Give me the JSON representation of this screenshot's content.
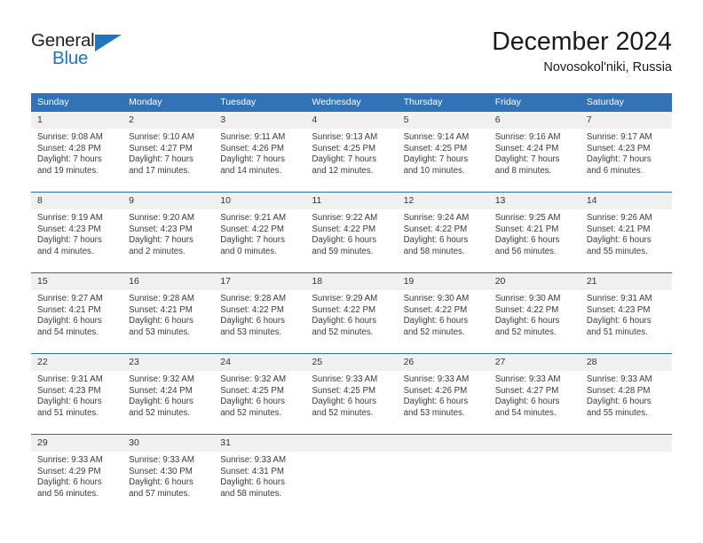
{
  "brand": {
    "name_top": "General",
    "name_bottom": "Blue",
    "color_dark": "#231f20",
    "color_blue": "#1f76bc"
  },
  "header": {
    "month_title": "December 2024",
    "location": "Novosokol'niki, Russia"
  },
  "theme": {
    "header_bg": "#3273b7",
    "row_divider": "#2e6da8",
    "daynum_bg": "#f0f0f0",
    "text": "#3a3a3a"
  },
  "weekday_headers": [
    "Sunday",
    "Monday",
    "Tuesday",
    "Wednesday",
    "Thursday",
    "Friday",
    "Saturday"
  ],
  "weeks": [
    [
      {
        "day": "1",
        "sunrise": "Sunrise: 9:08 AM",
        "sunset": "Sunset: 4:28 PM",
        "daylight1": "Daylight: 7 hours",
        "daylight2": "and 19 minutes."
      },
      {
        "day": "2",
        "sunrise": "Sunrise: 9:10 AM",
        "sunset": "Sunset: 4:27 PM",
        "daylight1": "Daylight: 7 hours",
        "daylight2": "and 17 minutes."
      },
      {
        "day": "3",
        "sunrise": "Sunrise: 9:11 AM",
        "sunset": "Sunset: 4:26 PM",
        "daylight1": "Daylight: 7 hours",
        "daylight2": "and 14 minutes."
      },
      {
        "day": "4",
        "sunrise": "Sunrise: 9:13 AM",
        "sunset": "Sunset: 4:25 PM",
        "daylight1": "Daylight: 7 hours",
        "daylight2": "and 12 minutes."
      },
      {
        "day": "5",
        "sunrise": "Sunrise: 9:14 AM",
        "sunset": "Sunset: 4:25 PM",
        "daylight1": "Daylight: 7 hours",
        "daylight2": "and 10 minutes."
      },
      {
        "day": "6",
        "sunrise": "Sunrise: 9:16 AM",
        "sunset": "Sunset: 4:24 PM",
        "daylight1": "Daylight: 7 hours",
        "daylight2": "and 8 minutes."
      },
      {
        "day": "7",
        "sunrise": "Sunrise: 9:17 AM",
        "sunset": "Sunset: 4:23 PM",
        "daylight1": "Daylight: 7 hours",
        "daylight2": "and 6 minutes."
      }
    ],
    [
      {
        "day": "8",
        "sunrise": "Sunrise: 9:19 AM",
        "sunset": "Sunset: 4:23 PM",
        "daylight1": "Daylight: 7 hours",
        "daylight2": "and 4 minutes."
      },
      {
        "day": "9",
        "sunrise": "Sunrise: 9:20 AM",
        "sunset": "Sunset: 4:23 PM",
        "daylight1": "Daylight: 7 hours",
        "daylight2": "and 2 minutes."
      },
      {
        "day": "10",
        "sunrise": "Sunrise: 9:21 AM",
        "sunset": "Sunset: 4:22 PM",
        "daylight1": "Daylight: 7 hours",
        "daylight2": "and 0 minutes."
      },
      {
        "day": "11",
        "sunrise": "Sunrise: 9:22 AM",
        "sunset": "Sunset: 4:22 PM",
        "daylight1": "Daylight: 6 hours",
        "daylight2": "and 59 minutes."
      },
      {
        "day": "12",
        "sunrise": "Sunrise: 9:24 AM",
        "sunset": "Sunset: 4:22 PM",
        "daylight1": "Daylight: 6 hours",
        "daylight2": "and 58 minutes."
      },
      {
        "day": "13",
        "sunrise": "Sunrise: 9:25 AM",
        "sunset": "Sunset: 4:21 PM",
        "daylight1": "Daylight: 6 hours",
        "daylight2": "and 56 minutes."
      },
      {
        "day": "14",
        "sunrise": "Sunrise: 9:26 AM",
        "sunset": "Sunset: 4:21 PM",
        "daylight1": "Daylight: 6 hours",
        "daylight2": "and 55 minutes."
      }
    ],
    [
      {
        "day": "15",
        "sunrise": "Sunrise: 9:27 AM",
        "sunset": "Sunset: 4:21 PM",
        "daylight1": "Daylight: 6 hours",
        "daylight2": "and 54 minutes."
      },
      {
        "day": "16",
        "sunrise": "Sunrise: 9:28 AM",
        "sunset": "Sunset: 4:21 PM",
        "daylight1": "Daylight: 6 hours",
        "daylight2": "and 53 minutes."
      },
      {
        "day": "17",
        "sunrise": "Sunrise: 9:28 AM",
        "sunset": "Sunset: 4:22 PM",
        "daylight1": "Daylight: 6 hours",
        "daylight2": "and 53 minutes."
      },
      {
        "day": "18",
        "sunrise": "Sunrise: 9:29 AM",
        "sunset": "Sunset: 4:22 PM",
        "daylight1": "Daylight: 6 hours",
        "daylight2": "and 52 minutes."
      },
      {
        "day": "19",
        "sunrise": "Sunrise: 9:30 AM",
        "sunset": "Sunset: 4:22 PM",
        "daylight1": "Daylight: 6 hours",
        "daylight2": "and 52 minutes."
      },
      {
        "day": "20",
        "sunrise": "Sunrise: 9:30 AM",
        "sunset": "Sunset: 4:22 PM",
        "daylight1": "Daylight: 6 hours",
        "daylight2": "and 52 minutes."
      },
      {
        "day": "21",
        "sunrise": "Sunrise: 9:31 AM",
        "sunset": "Sunset: 4:23 PM",
        "daylight1": "Daylight: 6 hours",
        "daylight2": "and 51 minutes."
      }
    ],
    [
      {
        "day": "22",
        "sunrise": "Sunrise: 9:31 AM",
        "sunset": "Sunset: 4:23 PM",
        "daylight1": "Daylight: 6 hours",
        "daylight2": "and 51 minutes."
      },
      {
        "day": "23",
        "sunrise": "Sunrise: 9:32 AM",
        "sunset": "Sunset: 4:24 PM",
        "daylight1": "Daylight: 6 hours",
        "daylight2": "and 52 minutes."
      },
      {
        "day": "24",
        "sunrise": "Sunrise: 9:32 AM",
        "sunset": "Sunset: 4:25 PM",
        "daylight1": "Daylight: 6 hours",
        "daylight2": "and 52 minutes."
      },
      {
        "day": "25",
        "sunrise": "Sunrise: 9:33 AM",
        "sunset": "Sunset: 4:25 PM",
        "daylight1": "Daylight: 6 hours",
        "daylight2": "and 52 minutes."
      },
      {
        "day": "26",
        "sunrise": "Sunrise: 9:33 AM",
        "sunset": "Sunset: 4:26 PM",
        "daylight1": "Daylight: 6 hours",
        "daylight2": "and 53 minutes."
      },
      {
        "day": "27",
        "sunrise": "Sunrise: 9:33 AM",
        "sunset": "Sunset: 4:27 PM",
        "daylight1": "Daylight: 6 hours",
        "daylight2": "and 54 minutes."
      },
      {
        "day": "28",
        "sunrise": "Sunrise: 9:33 AM",
        "sunset": "Sunset: 4:28 PM",
        "daylight1": "Daylight: 6 hours",
        "daylight2": "and 55 minutes."
      }
    ],
    [
      {
        "day": "29",
        "sunrise": "Sunrise: 9:33 AM",
        "sunset": "Sunset: 4:29 PM",
        "daylight1": "Daylight: 6 hours",
        "daylight2": "and 56 minutes."
      },
      {
        "day": "30",
        "sunrise": "Sunrise: 9:33 AM",
        "sunset": "Sunset: 4:30 PM",
        "daylight1": "Daylight: 6 hours",
        "daylight2": "and 57 minutes."
      },
      {
        "day": "31",
        "sunrise": "Sunrise: 9:33 AM",
        "sunset": "Sunset: 4:31 PM",
        "daylight1": "Daylight: 6 hours",
        "daylight2": "and 58 minutes."
      },
      {
        "day": "",
        "sunrise": "",
        "sunset": "",
        "daylight1": "",
        "daylight2": ""
      },
      {
        "day": "",
        "sunrise": "",
        "sunset": "",
        "daylight1": "",
        "daylight2": ""
      },
      {
        "day": "",
        "sunrise": "",
        "sunset": "",
        "daylight1": "",
        "daylight2": ""
      },
      {
        "day": "",
        "sunrise": "",
        "sunset": "",
        "daylight1": "",
        "daylight2": ""
      }
    ]
  ]
}
